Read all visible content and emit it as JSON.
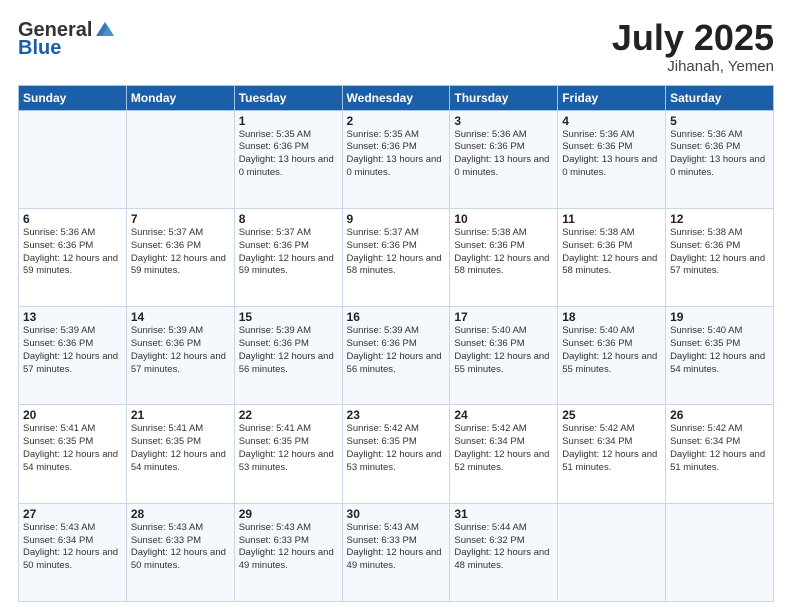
{
  "header": {
    "logo_general": "General",
    "logo_blue": "Blue",
    "month_year": "July 2025",
    "location": "Jihanah, Yemen"
  },
  "days_of_week": [
    "Sunday",
    "Monday",
    "Tuesday",
    "Wednesday",
    "Thursday",
    "Friday",
    "Saturday"
  ],
  "weeks": [
    [
      {
        "day": "",
        "info": ""
      },
      {
        "day": "",
        "info": ""
      },
      {
        "day": "1",
        "info": "Sunrise: 5:35 AM\nSunset: 6:36 PM\nDaylight: 13 hours and 0 minutes."
      },
      {
        "day": "2",
        "info": "Sunrise: 5:35 AM\nSunset: 6:36 PM\nDaylight: 13 hours and 0 minutes."
      },
      {
        "day": "3",
        "info": "Sunrise: 5:36 AM\nSunset: 6:36 PM\nDaylight: 13 hours and 0 minutes."
      },
      {
        "day": "4",
        "info": "Sunrise: 5:36 AM\nSunset: 6:36 PM\nDaylight: 13 hours and 0 minutes."
      },
      {
        "day": "5",
        "info": "Sunrise: 5:36 AM\nSunset: 6:36 PM\nDaylight: 13 hours and 0 minutes."
      }
    ],
    [
      {
        "day": "6",
        "info": "Sunrise: 5:36 AM\nSunset: 6:36 PM\nDaylight: 12 hours and 59 minutes."
      },
      {
        "day": "7",
        "info": "Sunrise: 5:37 AM\nSunset: 6:36 PM\nDaylight: 12 hours and 59 minutes."
      },
      {
        "day": "8",
        "info": "Sunrise: 5:37 AM\nSunset: 6:36 PM\nDaylight: 12 hours and 59 minutes."
      },
      {
        "day": "9",
        "info": "Sunrise: 5:37 AM\nSunset: 6:36 PM\nDaylight: 12 hours and 58 minutes."
      },
      {
        "day": "10",
        "info": "Sunrise: 5:38 AM\nSunset: 6:36 PM\nDaylight: 12 hours and 58 minutes."
      },
      {
        "day": "11",
        "info": "Sunrise: 5:38 AM\nSunset: 6:36 PM\nDaylight: 12 hours and 58 minutes."
      },
      {
        "day": "12",
        "info": "Sunrise: 5:38 AM\nSunset: 6:36 PM\nDaylight: 12 hours and 57 minutes."
      }
    ],
    [
      {
        "day": "13",
        "info": "Sunrise: 5:39 AM\nSunset: 6:36 PM\nDaylight: 12 hours and 57 minutes."
      },
      {
        "day": "14",
        "info": "Sunrise: 5:39 AM\nSunset: 6:36 PM\nDaylight: 12 hours and 57 minutes."
      },
      {
        "day": "15",
        "info": "Sunrise: 5:39 AM\nSunset: 6:36 PM\nDaylight: 12 hours and 56 minutes."
      },
      {
        "day": "16",
        "info": "Sunrise: 5:39 AM\nSunset: 6:36 PM\nDaylight: 12 hours and 56 minutes."
      },
      {
        "day": "17",
        "info": "Sunrise: 5:40 AM\nSunset: 6:36 PM\nDaylight: 12 hours and 55 minutes."
      },
      {
        "day": "18",
        "info": "Sunrise: 5:40 AM\nSunset: 6:36 PM\nDaylight: 12 hours and 55 minutes."
      },
      {
        "day": "19",
        "info": "Sunrise: 5:40 AM\nSunset: 6:35 PM\nDaylight: 12 hours and 54 minutes."
      }
    ],
    [
      {
        "day": "20",
        "info": "Sunrise: 5:41 AM\nSunset: 6:35 PM\nDaylight: 12 hours and 54 minutes."
      },
      {
        "day": "21",
        "info": "Sunrise: 5:41 AM\nSunset: 6:35 PM\nDaylight: 12 hours and 54 minutes."
      },
      {
        "day": "22",
        "info": "Sunrise: 5:41 AM\nSunset: 6:35 PM\nDaylight: 12 hours and 53 minutes."
      },
      {
        "day": "23",
        "info": "Sunrise: 5:42 AM\nSunset: 6:35 PM\nDaylight: 12 hours and 53 minutes."
      },
      {
        "day": "24",
        "info": "Sunrise: 5:42 AM\nSunset: 6:34 PM\nDaylight: 12 hours and 52 minutes."
      },
      {
        "day": "25",
        "info": "Sunrise: 5:42 AM\nSunset: 6:34 PM\nDaylight: 12 hours and 51 minutes."
      },
      {
        "day": "26",
        "info": "Sunrise: 5:42 AM\nSunset: 6:34 PM\nDaylight: 12 hours and 51 minutes."
      }
    ],
    [
      {
        "day": "27",
        "info": "Sunrise: 5:43 AM\nSunset: 6:34 PM\nDaylight: 12 hours and 50 minutes."
      },
      {
        "day": "28",
        "info": "Sunrise: 5:43 AM\nSunset: 6:33 PM\nDaylight: 12 hours and 50 minutes."
      },
      {
        "day": "29",
        "info": "Sunrise: 5:43 AM\nSunset: 6:33 PM\nDaylight: 12 hours and 49 minutes."
      },
      {
        "day": "30",
        "info": "Sunrise: 5:43 AM\nSunset: 6:33 PM\nDaylight: 12 hours and 49 minutes."
      },
      {
        "day": "31",
        "info": "Sunrise: 5:44 AM\nSunset: 6:32 PM\nDaylight: 12 hours and 48 minutes."
      },
      {
        "day": "",
        "info": ""
      },
      {
        "day": "",
        "info": ""
      }
    ]
  ]
}
